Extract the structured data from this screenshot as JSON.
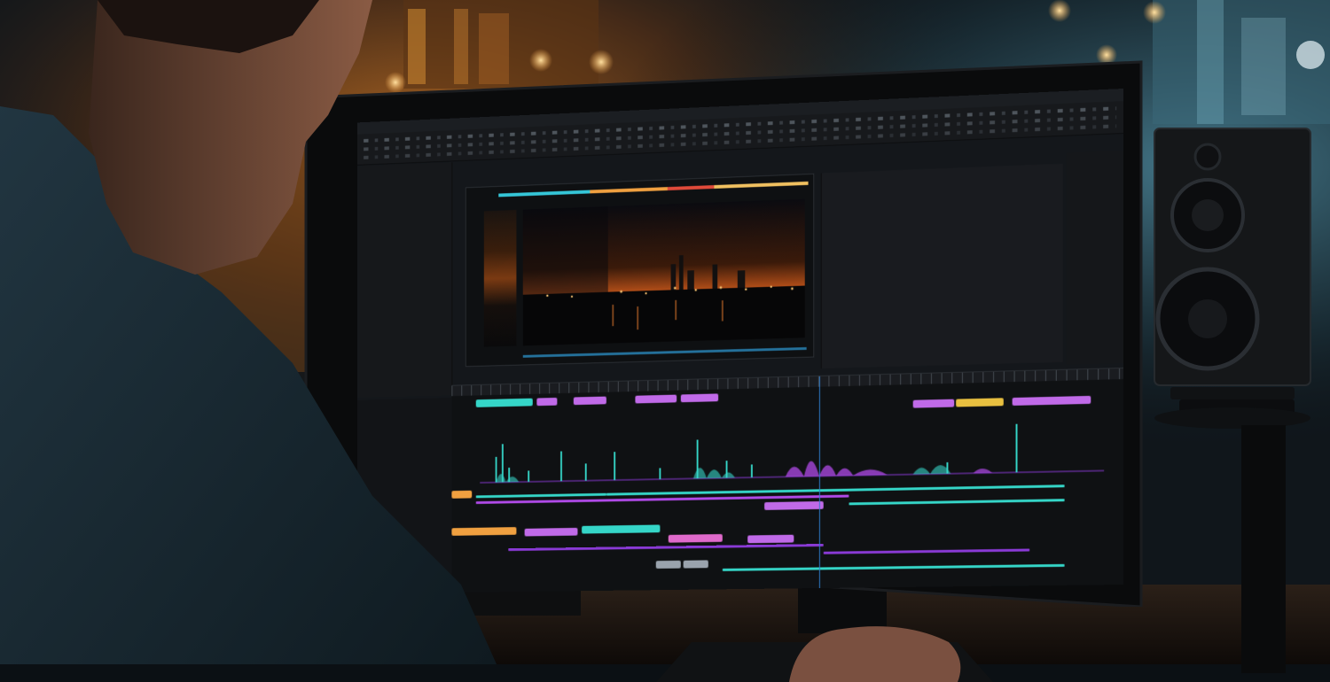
{
  "scene": {
    "description_type": "photo",
    "colors": {
      "background_warm": "#6b3d17",
      "background_cool": "#2b4a55",
      "monitor_bezel": "#0a0b0c",
      "speaker": "#141618",
      "person_shirt": "#1f3440",
      "skin": "#8a5b44"
    }
  },
  "screen": {
    "app_title": "",
    "accent_colors": {
      "cyan": "#35d6c8",
      "magenta": "#b04ae8",
      "purple": "#8a3ad6",
      "orange": "#f0a040",
      "yellow": "#e8c040",
      "blue": "#2d8fe0",
      "red": "#e0412f"
    }
  }
}
